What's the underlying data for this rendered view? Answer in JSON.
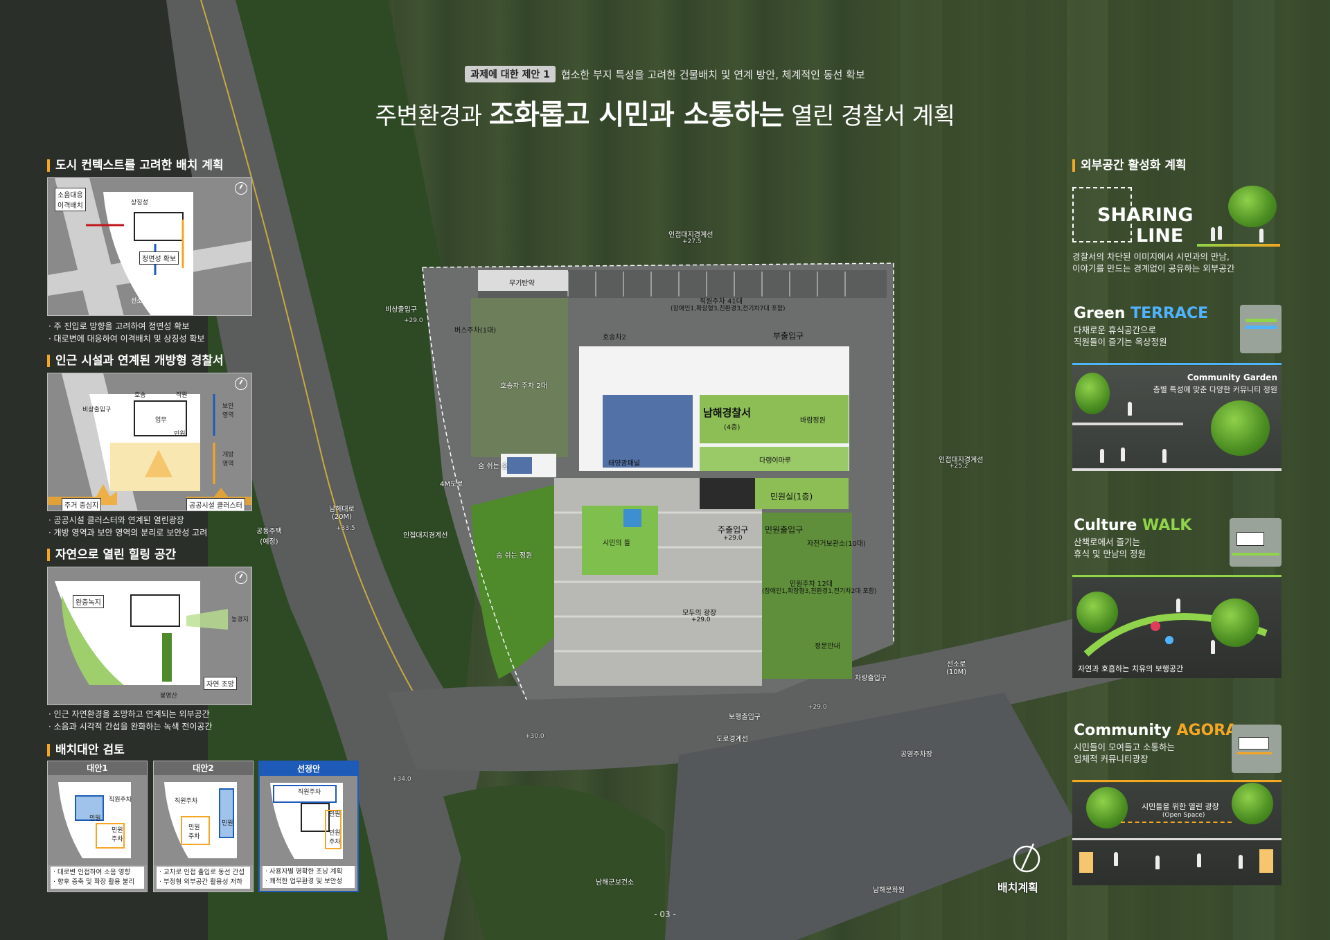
{
  "header": {
    "tag": "과제에 대한 제안 1",
    "subtitle": "협소한 부지 특성을 고려한 건물배치 및 연계 방안, 체계적인 동선 확보",
    "title_pre": "주변환경과 ",
    "title_bold": "조화롭고 시민과 소통하는",
    "title_post": " 열린 경찰서 계획"
  },
  "left": {
    "sec1": {
      "title": "도시 컨텍스트를 고려한 배치 계획",
      "labels": {
        "noise": "소음대응\n이격배치",
        "symbol": "상징성",
        "front": "정면성 확보",
        "road": "선소로(10M)"
      },
      "notes": [
        "주 진입로 방향을 고려하여 정면성 확보",
        "대로변에 대응하여 이격배치 및 상징성 확보"
      ]
    },
    "sec2": {
      "title": "인근 시설과 연계된 개방형 경찰서",
      "labels": {
        "emergency": "비상출입구",
        "escort": "호송",
        "staff": "직원",
        "work": "업무",
        "civil": "민원",
        "security": "보안\n영역",
        "open": "개방\n영역",
        "residential": "주거 중심지",
        "public": "공공시설 클러스터"
      },
      "notes": [
        "공공시설 클러스터와 연계된 열린광장",
        "개방 영역과 보안 영역의 분리로 보안성 고려"
      ]
    },
    "sec3": {
      "title": "자연으로 열린 힐링 공간",
      "labels": {
        "buffer": "완충녹지",
        "view": "자연 조망",
        "mountain": "봉명산",
        "field": "농경지"
      },
      "notes": [
        "인근 자연환경을 조망하고 연계되는 외부공간",
        "소음과 시각적 간섭을 완화하는 녹색 전이공간"
      ]
    },
    "sec4": {
      "title": "배치대안 검토",
      "alts": [
        {
          "name": "대안1",
          "tags": [
            "직원주차",
            "민원",
            "민원\n주차"
          ],
          "notes": [
            "대로변 인접하여 소음 영향",
            "향후 증축 및 확장 활용 불리"
          ]
        },
        {
          "name": "대안2",
          "tags": [
            "직원주차",
            "민원\n주차",
            "민원"
          ],
          "notes": [
            "교차로 인접 출입로 동선 간섭",
            "부정형 외부공간 활용성 저하"
          ]
        },
        {
          "name": "선정안",
          "tags": [
            "직원주차",
            "민원",
            "민원\n주차"
          ],
          "notes": [
            "사용자별 명확한 조닝 계획",
            "쾌적한 업무환경 및 보안성"
          ]
        }
      ]
    }
  },
  "map": {
    "building": "남해경찰서",
    "building_floors": "(4층)",
    "boundary_top": "인접대지경계선",
    "elev_top": "+27.5",
    "boundary_right": "인접대지경계선",
    "elev_right": "+25.2",
    "boundary_left": "인접대지경계선",
    "road_main": "남해대로\n(20M)",
    "elev_main": "+33.5",
    "housing": "공동주택\n(예정)",
    "road_4m": "4M도로",
    "emergency_entry": "비상출입구",
    "elev_emergency": "+29.0",
    "armory": "무기탄약",
    "staff_parking": "직원주차 41대",
    "staff_parking_note": "(장애인1,확장형3,친환경3,전기차7대 포함)",
    "bus_parking": "버스주차(1대)",
    "escort_parking": "호송차2",
    "escort_vehicle": "호송차 주차 2대",
    "side_entry": "부출입구",
    "roof_garden": "바람정원",
    "terrace": "다랭이마루",
    "civil_wing": "민원실(1층)",
    "main_entry": "주출입구",
    "elev_main_entry": "+29.0",
    "civil_entry": "민원출입구",
    "bike": "자전거보관소(10대)",
    "plaza": "시민의 뜰",
    "forest1": "숨 쉬는 숲",
    "forest2": "숨 쉬는 정원",
    "hall": "모두의 광장",
    "elev_hall": "+29.0",
    "civil_parking": "민원주차 12대",
    "civil_parking_note": "(장애인1,확장형3,친환경1,전기차2대 포함)",
    "guard": "정문안내",
    "vehicle_entry": "차량출입구",
    "ped_entry": "보행출입구",
    "seonso_road": "선소로\n(10M)",
    "road_boundary": "도로경계선",
    "elev_road": "+29.0",
    "elev_30": "+30.0",
    "elev_34": "+34.0",
    "public_parking": "공영주차장",
    "health_center": "남해군보건소",
    "culture_center": "남해문화원",
    "solar": "태양광패널",
    "site_plan": "배치계획"
  },
  "right": {
    "title": "외부공간 활성화 계획",
    "sharing": {
      "line1": "SHARING",
      "line2": "LINE",
      "desc": "경찰서의 차단된 이미지에서 시민과의 만남,\n이야기를 만드는 경계없이 공유하는 외부공간"
    },
    "green": {
      "w1": "Green ",
      "w2": "TERRACE",
      "desc": "다채로운 휴식공간으로\n직원들이 즐기는 옥상정원",
      "cg_title": "Community Garden",
      "cg_desc": "층별 특성에 맞춘 다양한 커뮤니티 정원"
    },
    "culture": {
      "w1": "Culture ",
      "w2": "WALK",
      "desc": "산책로에서 즐기는\n휴식 및 만남의 정원",
      "caption": "자연과 호흡하는 치유의 보행공간"
    },
    "agora": {
      "w1": "Community ",
      "w2": "AGORA",
      "desc": "시민들이 모여들고 소통하는\n입체적 커뮤니티광장",
      "plaza": "시민들을 위한 열린 광장",
      "open": "(Open Space)"
    }
  },
  "page": "- 03 -",
  "colors": {
    "accent": "#f5a623",
    "blue": "#1e5bb8",
    "green": "#8fd44a"
  }
}
